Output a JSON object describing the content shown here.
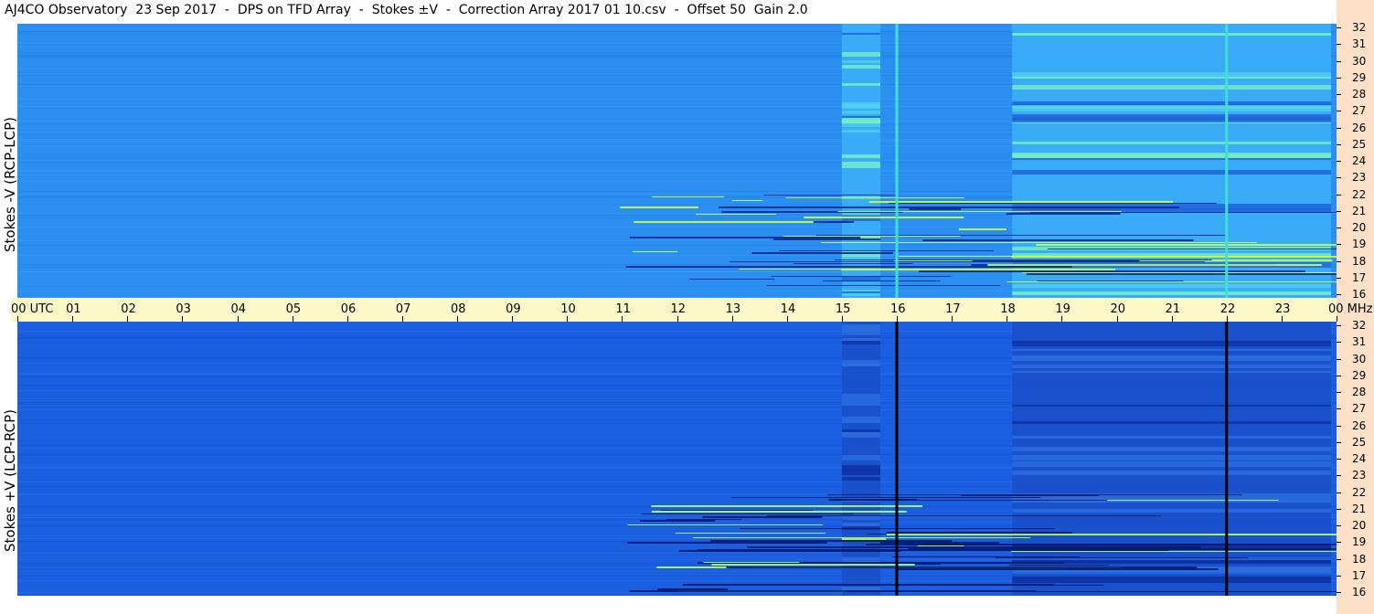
{
  "title": "AJ4CO Observatory  23 Sep 2017  -  DPS on TFD Array  -  Stokes ±V  -  Correction Array 2017 01 10.csv  -  Offset 50  Gain 2.0",
  "colors": {
    "top_base": "#2a8ff0",
    "bottom_base": "#1a5fe0",
    "time_strip": "#fdf8c8",
    "right_strip": "#fde0c8",
    "highlight": "#c8ff40"
  },
  "chart_data": [
    {
      "type": "heatmap",
      "name": "Stokes -V (RCP-LCP)",
      "ylabel": "Stokes -V (RCP-LCP)",
      "x_unit": "UTC",
      "y_unit": "MHz",
      "xlim": [
        0,
        24
      ],
      "ylim": [
        16,
        32
      ],
      "y_ticks": [
        "32",
        "31",
        "30",
        "29",
        "28",
        "27",
        "26",
        "25",
        "24",
        "23",
        "22",
        "21",
        "20",
        "19",
        "18",
        "17",
        "16"
      ],
      "bright_time_bands": [
        [
          15.0,
          15.7
        ],
        [
          18.1,
          23.9
        ]
      ],
      "vertical_lines": [
        16.0,
        22.0
      ],
      "vertical_line_color": "#40e0d0"
    },
    {
      "type": "heatmap",
      "name": "Stokes +V (LCP-RCP)",
      "ylabel": "Stokes +V (LCP-RCP)",
      "x_unit": "UTC",
      "y_unit": "MHz",
      "xlim": [
        0,
        24
      ],
      "ylim": [
        16,
        32
      ],
      "y_ticks": [
        "32",
        "31",
        "30",
        "29",
        "28",
        "27",
        "26",
        "25",
        "24",
        "23",
        "22",
        "21",
        "20",
        "19",
        "18",
        "17",
        "16"
      ],
      "dark_time_bands": [
        [
          15.0,
          15.7
        ],
        [
          18.1,
          23.9
        ]
      ],
      "vertical_lines": [
        16.0,
        22.0
      ],
      "vertical_line_color": "#000000"
    }
  ],
  "time_axis": {
    "labels": [
      "00 UTC",
      "01",
      "02",
      "03",
      "04",
      "05",
      "06",
      "07",
      "08",
      "09",
      "10",
      "11",
      "12",
      "13",
      "14",
      "15",
      "16",
      "17",
      "18",
      "19",
      "20",
      "21",
      "22",
      "23",
      "00 MHz"
    ]
  }
}
